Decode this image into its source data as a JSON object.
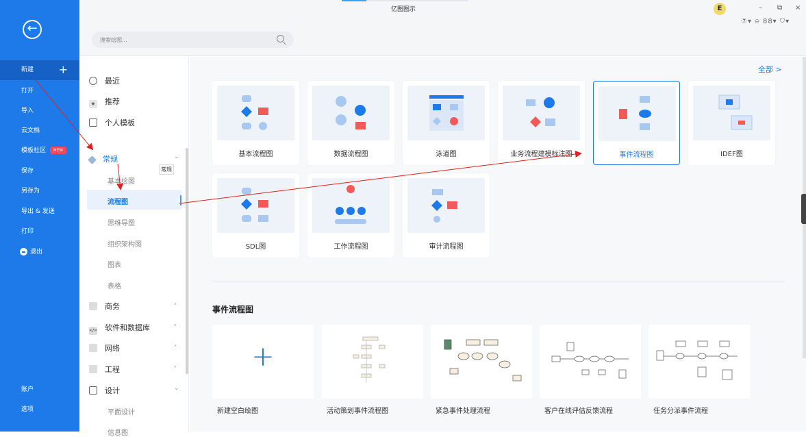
{
  "app": {
    "title": "亿图图示",
    "avatar": "E",
    "win_min": "–",
    "win_max": "⧉",
    "win_close": "×",
    "top_icons": "⑦▾ ⍾ 88▾ ⛉▾"
  },
  "search": {
    "placeholder": "搜索绘图..."
  },
  "left_nav": [
    {
      "label": "新建",
      "icon": "plus"
    },
    {
      "label": "打开"
    },
    {
      "label": "导入"
    },
    {
      "label": "云文档"
    },
    {
      "label": "模板社区",
      "badge": "NEW"
    },
    {
      "label": "保存"
    },
    {
      "label": "另存为"
    },
    {
      "label": "导出 & 发送"
    },
    {
      "label": "打印"
    },
    {
      "label": "退出"
    }
  ],
  "left_bottom": [
    {
      "label": "账户"
    },
    {
      "label": "选项"
    }
  ],
  "categories": {
    "top": [
      {
        "label": "最近"
      },
      {
        "label": "推荐"
      },
      {
        "label": "个人模板"
      }
    ],
    "general": {
      "label": "常规",
      "tooltip": "常规",
      "chev": "⌄"
    },
    "sub": [
      "基本绘图",
      "流程图",
      "思维导图",
      "组织架构图",
      "图表",
      "表格"
    ],
    "groups": [
      {
        "label": "商务",
        "chev": "›"
      },
      {
        "label": "软件和数据库",
        "chev": "›"
      },
      {
        "label": "网络",
        "chev": "›"
      },
      {
        "label": "工程",
        "chev": "›"
      },
      {
        "label": "设计",
        "chev": "⌄"
      }
    ],
    "design_sub": [
      "平面设计",
      "信息图"
    ]
  },
  "main": {
    "all_label": "全部 >",
    "cards": [
      "基本流程图",
      "数据流程图",
      "泳道图",
      "业务流程建模标注图",
      "事件流程图",
      "IDEF图",
      "SDL图",
      "工作流程图",
      "审计流程图"
    ],
    "section_title": "事件流程图",
    "templates": [
      "新建空白绘图",
      "活动策划事件流程图",
      "紧急事件处理流程",
      "客户在线评估反馈流程",
      "任务分派事件流程"
    ],
    "blank_plus": "+"
  },
  "colors": {
    "sidebar": "#1e7ae8",
    "accent": "#1e7ae8",
    "red": "#f25a5a",
    "arrow": "#e02020"
  }
}
